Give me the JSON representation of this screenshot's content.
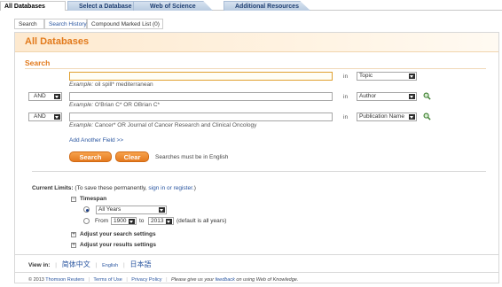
{
  "tabs": [
    {
      "label": "All Databases",
      "active": true
    },
    {
      "label": "Select a Database",
      "active": false
    },
    {
      "label": "Web of Science",
      "active": false
    },
    {
      "label": "Additional Resources",
      "active": false
    }
  ],
  "subtabs": {
    "search": "Search",
    "history": "Search History",
    "marked": "Compound Marked List (0)"
  },
  "page_title": "All Databases",
  "search": {
    "heading": "Search",
    "rows": [
      {
        "value": "",
        "example_label": "Example:",
        "example": "oil spill* mediterranean",
        "in": "in",
        "field": "Topic"
      },
      {
        "bool": "AND",
        "value": "",
        "example_label": "Example:",
        "example": "O'Brian C* OR OBrian C*",
        "in": "in",
        "field": "Author"
      },
      {
        "bool": "AND",
        "value": "",
        "example_label": "Example:",
        "example": "Cancer* OR Journal of Cancer Research and Clinical Oncology",
        "in": "in",
        "field": "Publication Name"
      }
    ],
    "add_field": "Add Another Field >>",
    "search_button": "Search",
    "clear_button": "Clear",
    "note": "Searches must be in English"
  },
  "limits": {
    "label": "Current Limits:",
    "hint": "(To save these permanently,",
    "signin": "sign in or register.",
    "hint_end": ")",
    "timespan": "Timespan",
    "all_years": "All Years",
    "from": "From",
    "from_year": "1900",
    "to": "to",
    "to_year": "2013",
    "default_note": "(default is all years)",
    "adjust_search": "Adjust your search settings",
    "adjust_results": "Adjust your results settings"
  },
  "view_in": {
    "label": "View in:",
    "lang1": "简体中文",
    "lang2": "English",
    "lang3": "日本語"
  },
  "footer": {
    "copyright": "© 2013",
    "company": "Thomson Reuters",
    "terms": "Terms of Use",
    "privacy": "Privacy Policy",
    "feedback_pre": "Please give us your",
    "feedback": "feedback",
    "feedback_post": "on using Web of Knowledge."
  },
  "colors": {
    "accent": "#e27a1c",
    "link": "#2a56a0"
  }
}
